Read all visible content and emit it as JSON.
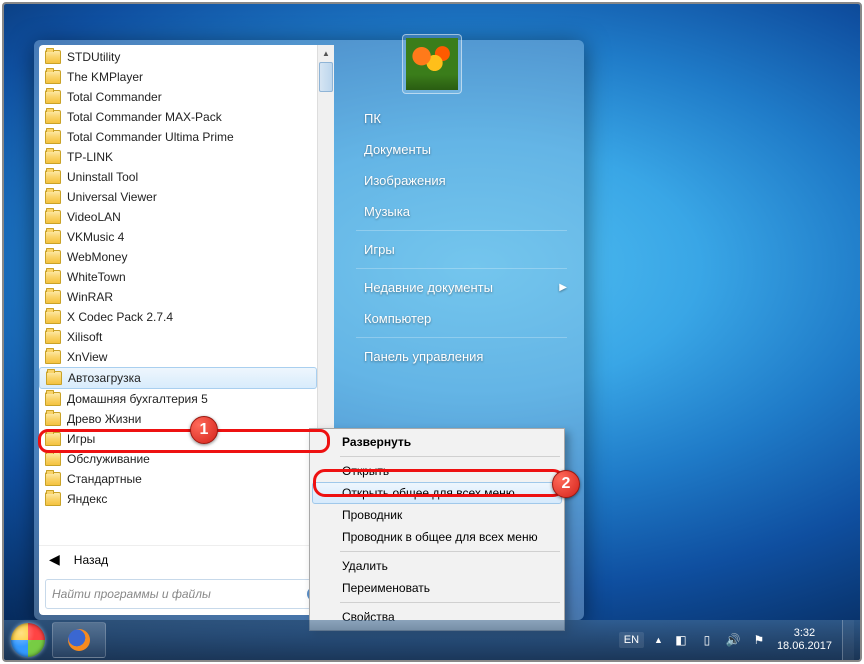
{
  "startmenu": {
    "items": [
      {
        "label": "STDUtility"
      },
      {
        "label": "The KMPlayer"
      },
      {
        "label": "Total Commander"
      },
      {
        "label": "Total Commander MAX-Pack"
      },
      {
        "label": "Total Commander Ultima Prime"
      },
      {
        "label": "TP-LINK"
      },
      {
        "label": "Uninstall Tool"
      },
      {
        "label": "Universal Viewer"
      },
      {
        "label": "VideoLAN"
      },
      {
        "label": "VKMusic 4"
      },
      {
        "label": "WebMoney"
      },
      {
        "label": "WhiteTown"
      },
      {
        "label": "WinRAR"
      },
      {
        "label": "X Codec Pack 2.7.4"
      },
      {
        "label": "Xilisoft"
      },
      {
        "label": "XnView"
      },
      {
        "label": "Автозагрузка",
        "selected": true
      },
      {
        "label": "Домашняя бухгалтерия 5"
      },
      {
        "label": "Древо Жизни"
      },
      {
        "label": "Игры"
      },
      {
        "label": "Обслуживание"
      },
      {
        "label": "Стандартные"
      },
      {
        "label": "Яндекс"
      }
    ],
    "back_label": "Назад",
    "search_placeholder": "Найти программы и файлы"
  },
  "rightpanel": {
    "items": [
      {
        "label": "ПК"
      },
      {
        "label": "Документы"
      },
      {
        "label": "Изображения"
      },
      {
        "label": "Музыка"
      },
      {
        "sep": true
      },
      {
        "label": "Игры"
      },
      {
        "sep": true
      },
      {
        "label": "Недавние документы",
        "arrow": true
      },
      {
        "label": "Компьютер"
      },
      {
        "sep": true
      },
      {
        "label": "Панель управления"
      }
    ]
  },
  "contextmenu": {
    "items": [
      {
        "label": "Развернуть",
        "bold": true
      },
      {
        "sep": true
      },
      {
        "label": "Открыть"
      },
      {
        "label": "Открыть общее для всех меню",
        "hl": true
      },
      {
        "label": "Проводник"
      },
      {
        "label": "Проводник в общее для всех меню"
      },
      {
        "sep": true
      },
      {
        "label": "Удалить"
      },
      {
        "label": "Переименовать"
      },
      {
        "sep": true
      },
      {
        "label": "Свойства"
      }
    ]
  },
  "taskbar": {
    "lang": "EN",
    "time": "3:32",
    "date": "18.06.2017"
  },
  "markers": {
    "one": "1",
    "two": "2"
  }
}
